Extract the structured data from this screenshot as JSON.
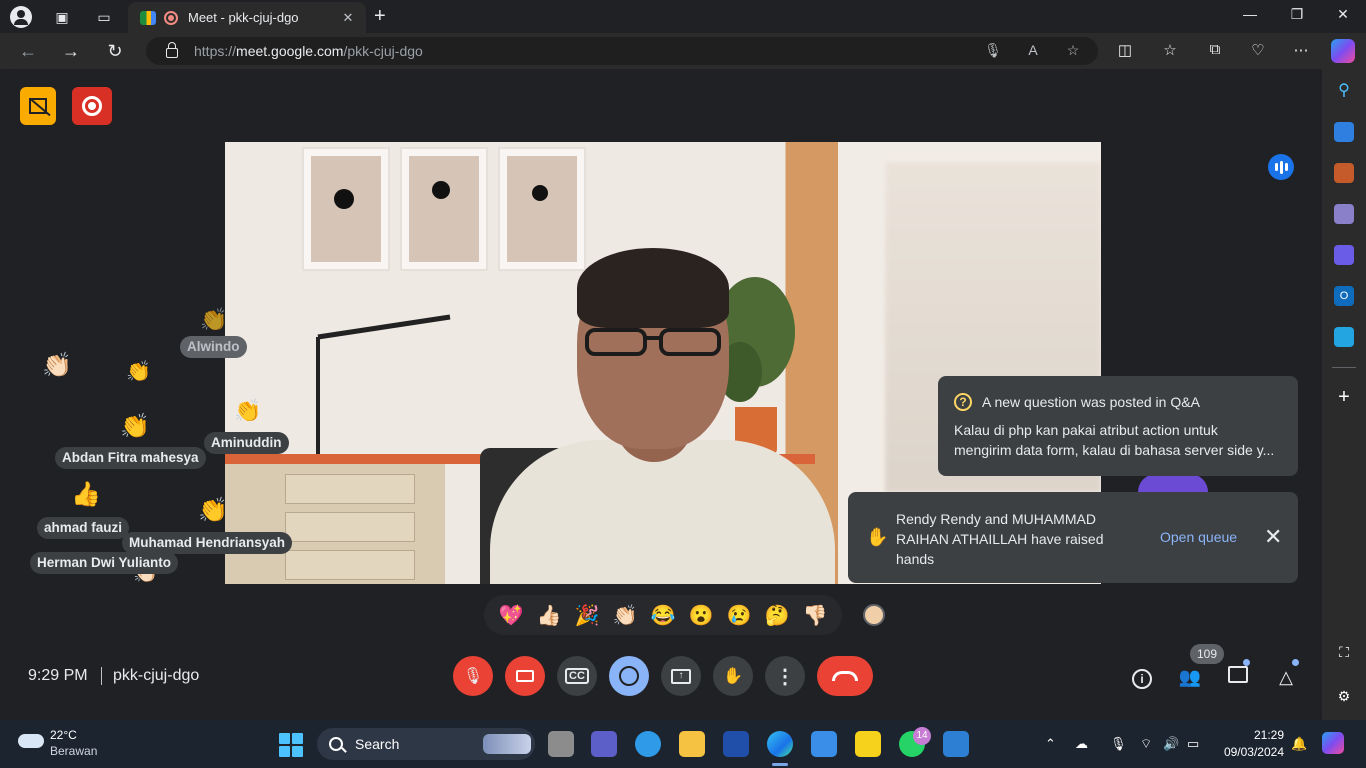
{
  "browser": {
    "tab_title": "Meet - pkk-cjuj-dgo",
    "url_host": "meet.google.com",
    "url_prefix": "https://",
    "url_path": "/pkk-cjuj-dgo"
  },
  "meet": {
    "floating_reactions": [
      {
        "emoji": "👏",
        "name": "Alwindo"
      },
      {
        "emoji": "👏🏻",
        "name": ""
      },
      {
        "emoji": "👏",
        "name": ""
      },
      {
        "emoji": "👏",
        "name": "Aminuddin"
      },
      {
        "emoji": "👏",
        "name": "Abdan Fitra mahesya"
      },
      {
        "emoji": "👍",
        "name": "ahmad fauzi"
      },
      {
        "emoji": "👏",
        "name": "Muhamad Hendriansyah"
      },
      {
        "emoji": "👏🏻",
        "name": "Herman Dwi Yulianto"
      }
    ],
    "qa_notification": {
      "title": "A new question was posted in Q&A",
      "body_line1": "Kalau di php kan pakai atribut action untuk",
      "body_line2": "mengirim data form, kalau di bahasa server side y..."
    },
    "hand_notification": {
      "text": "Rendy Rendy and MUHAMMAD RAIHAN ATHAILLAH have raised hands",
      "action": "Open queue"
    },
    "reactions": [
      "💖",
      "👍🏻",
      "🎉",
      "👏🏻",
      "😂",
      "😮",
      "😢",
      "🤔",
      "👎🏻"
    ],
    "time": "9:29 PM",
    "meeting_code": "pkk-cjuj-dgo",
    "participant_count": "109"
  },
  "taskbar": {
    "temperature": "22°C",
    "condition": "Berawan",
    "search_label": "Search",
    "whatsapp_badge": "14",
    "time": "21:29",
    "date": "09/03/2024"
  }
}
